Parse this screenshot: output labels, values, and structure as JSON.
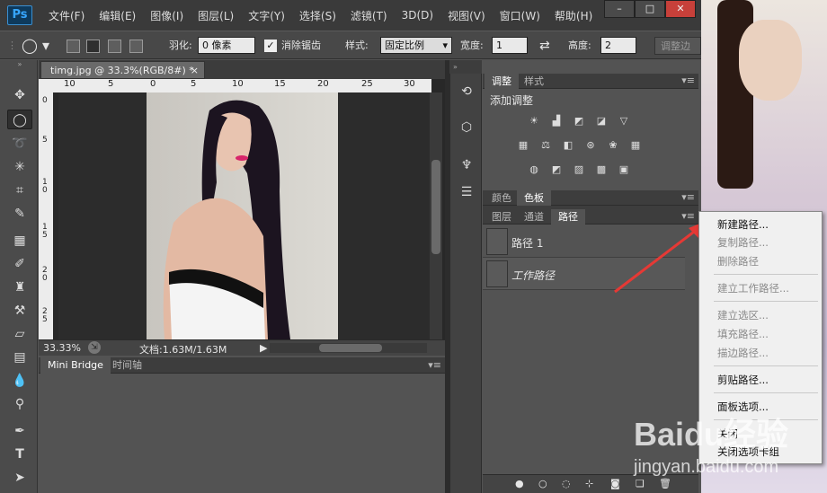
{
  "app": {
    "logo": "Ps"
  },
  "menu": [
    "文件(F)",
    "编辑(E)",
    "图像(I)",
    "图层(L)",
    "文字(Y)",
    "选择(S)",
    "滤镜(T)",
    "3D(D)",
    "视图(V)",
    "窗口(W)",
    "帮助(H)"
  ],
  "window_controls": {
    "minimize": "–",
    "maximize": "□",
    "close": "✕"
  },
  "options": {
    "feather_label": "羽化:",
    "feather_value": "0 像素",
    "antialias_label": "消除锯齿",
    "style_label": "样式:",
    "style_value": "固定比例",
    "width_label": "宽度:",
    "width_value": "1",
    "height_label": "高度:",
    "height_value": "2",
    "refine_button": "调整边"
  },
  "document": {
    "tab_title": "timg.jpg @ 33.3%(RGB/8#) *",
    "close": "×",
    "ruler_top": [
      "10",
      "5",
      "0",
      "5",
      "10",
      "15",
      "20",
      "25",
      "30"
    ],
    "ruler_left": [
      "0",
      "5",
      "1 0",
      "1 5",
      "2 0",
      "2 5"
    ],
    "zoom": "33.33%",
    "doc_info": "文档:1.63M/1.63M"
  },
  "minibridge": {
    "tabs": [
      "Mini Bridge",
      "时间轴"
    ]
  },
  "panels": {
    "adjust": {
      "tabs": [
        "调整",
        "样式"
      ],
      "title": "添加调整"
    },
    "color": {
      "tabs": [
        "颜色",
        "色板"
      ]
    },
    "layers": {
      "tabs": [
        "图层",
        "通道",
        "路径"
      ]
    },
    "paths": [
      {
        "name": "路径 1"
      },
      {
        "name": "工作路径"
      }
    ]
  },
  "context_menu": {
    "items": [
      {
        "label": "新建路径...",
        "enabled": true
      },
      {
        "label": "复制路径...",
        "enabled": false
      },
      {
        "label": "删除路径",
        "enabled": false
      },
      {
        "label": "建立工作路径...",
        "enabled": false
      },
      {
        "label": "建立选区...",
        "enabled": false
      },
      {
        "label": "填充路径...",
        "enabled": false
      },
      {
        "label": "描边路径...",
        "enabled": false
      },
      {
        "label": "剪贴路径...",
        "enabled": true
      },
      {
        "label": "面板选项...",
        "enabled": true
      },
      {
        "label": "关闭",
        "enabled": true
      },
      {
        "label": "关闭选项卡组",
        "enabled": true
      }
    ]
  },
  "watermark": {
    "text": "Baidu经验",
    "url": "jingyan.baidu.com"
  },
  "colors": {
    "accent": "#37a7ff",
    "arrow": "#e53935"
  }
}
